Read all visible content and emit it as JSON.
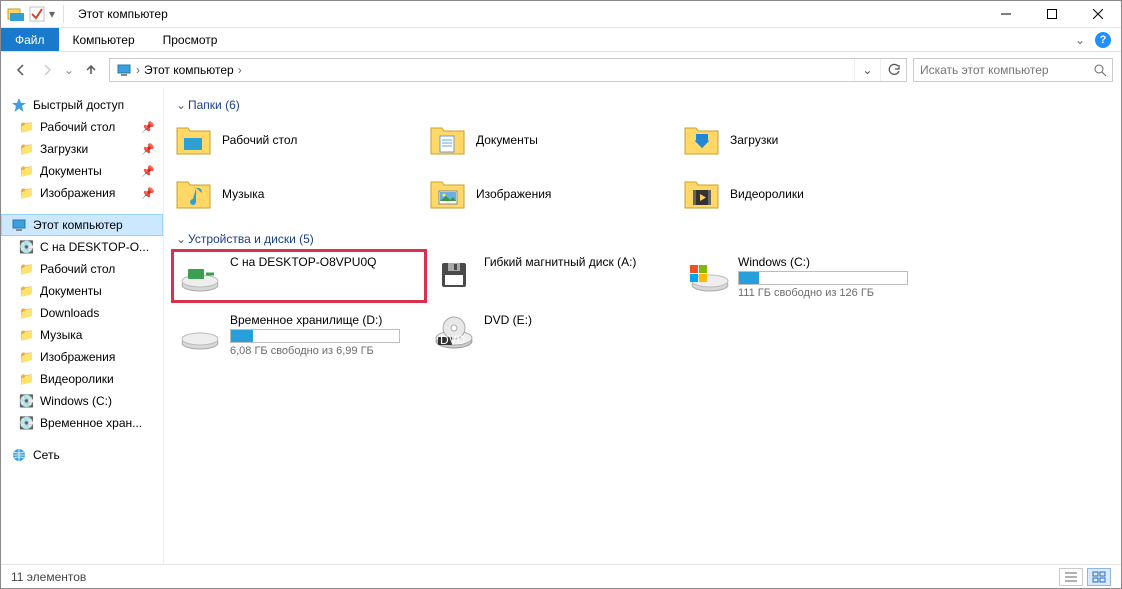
{
  "window": {
    "title": "Этот компьютер"
  },
  "ribbon": {
    "file": "Файл",
    "computer": "Компьютер",
    "view": "Просмотр"
  },
  "breadcrumb": {
    "root": "Этот компьютер"
  },
  "search": {
    "placeholder": "Искать этот компьютер"
  },
  "sidebar": {
    "quick_access": "Быстрый доступ",
    "qa_items": [
      {
        "label": "Рабочий стол"
      },
      {
        "label": "Загрузки"
      },
      {
        "label": "Документы"
      },
      {
        "label": "Изображения"
      }
    ],
    "this_pc": "Этот компьютер",
    "pc_items": [
      "C на DESKTOP-O...",
      "Рабочий стол",
      "Документы",
      "Downloads",
      "Музыка",
      "Изображения",
      "Видеоролики",
      "Windows (C:)",
      "Временное хран..."
    ],
    "network": "Сеть"
  },
  "sections": {
    "folders": {
      "title": "Папки (6)"
    },
    "devices": {
      "title": "Устройства и диски (5)"
    }
  },
  "folders": [
    {
      "label": "Рабочий стол"
    },
    {
      "label": "Документы"
    },
    {
      "label": "Загрузки"
    },
    {
      "label": "Музыка"
    },
    {
      "label": "Изображения"
    },
    {
      "label": "Видеоролики"
    }
  ],
  "drives": [
    {
      "label": "C на DESKTOP-O8VPU0Q",
      "highlight": true
    },
    {
      "label": "Гибкий магнитный диск (A:)"
    },
    {
      "label": "Windows (C:)",
      "bar_fill": 12,
      "sub": "111 ГБ свободно из 126 ГБ"
    },
    {
      "label": "Временное хранилище (D:)",
      "bar_fill": 13,
      "sub": "6,08 ГБ свободно из 6,99 ГБ"
    },
    {
      "label": "DVD (E:)"
    }
  ],
  "status": {
    "count_text": "11 элементов"
  }
}
